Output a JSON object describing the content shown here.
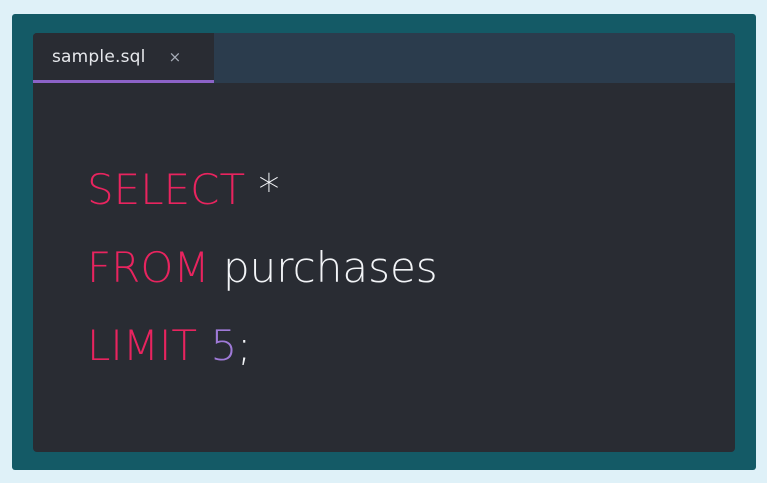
{
  "tab": {
    "filename": "sample.sql",
    "close_glyph": "×",
    "close_icon": "close-icon"
  },
  "code": {
    "lines": [
      {
        "keyword": "SELECT",
        "space": " ",
        "text": "*"
      },
      {
        "keyword": "FROM",
        "space": " ",
        "text": "purchases"
      },
      {
        "keyword": "LIMIT",
        "space": " ",
        "number": "5",
        "punct": ";"
      }
    ]
  },
  "colors": {
    "page_bg": "#dff1f8",
    "frame_bg": "#145a66",
    "editor_bg": "#292c33",
    "tabbar_bg": "#2b3c4d",
    "tab_underline": "#8c63c8",
    "keyword": "#e8245f",
    "plain_text": "#f2f4f7",
    "number": "#9f7ad8"
  }
}
